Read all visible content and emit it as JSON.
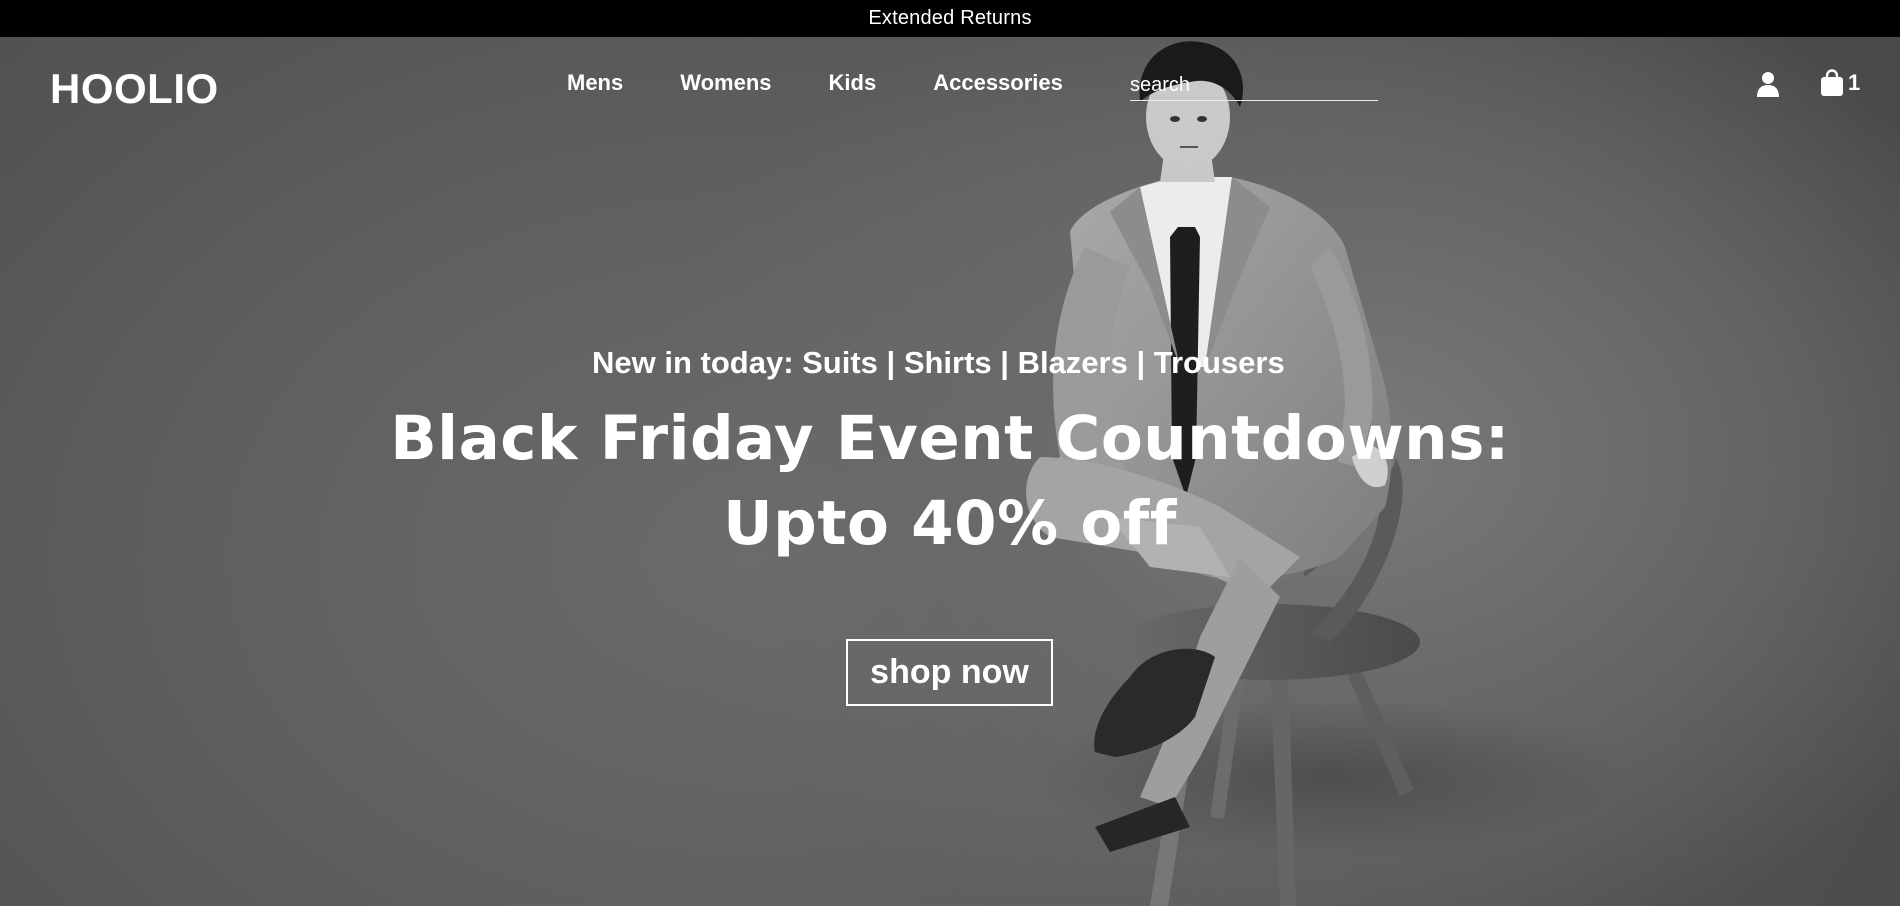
{
  "announcement": {
    "text": "Extended Returns"
  },
  "header": {
    "logo": "HOOLIO",
    "nav": [
      {
        "label": "Mens"
      },
      {
        "label": "Womens"
      },
      {
        "label": "Kids"
      },
      {
        "label": "Accessories"
      }
    ],
    "search": {
      "placeholder": "search",
      "value": ""
    },
    "account_icon": "user-icon",
    "cart": {
      "icon": "shopping-bag-icon",
      "count": "1"
    }
  },
  "hero": {
    "subtitle": "New in today: Suits | Shirts | Blazers | Trousers",
    "title_line1": "Black Friday Event Countdowns:",
    "title_line2": "Upto 40% off",
    "cta_label": "shop now",
    "image": "man-in-suit-sitting-on-chair"
  },
  "colors": {
    "announcement_bg": "#000000",
    "text": "#ffffff",
    "hero_bg": "#5e5e5e"
  }
}
